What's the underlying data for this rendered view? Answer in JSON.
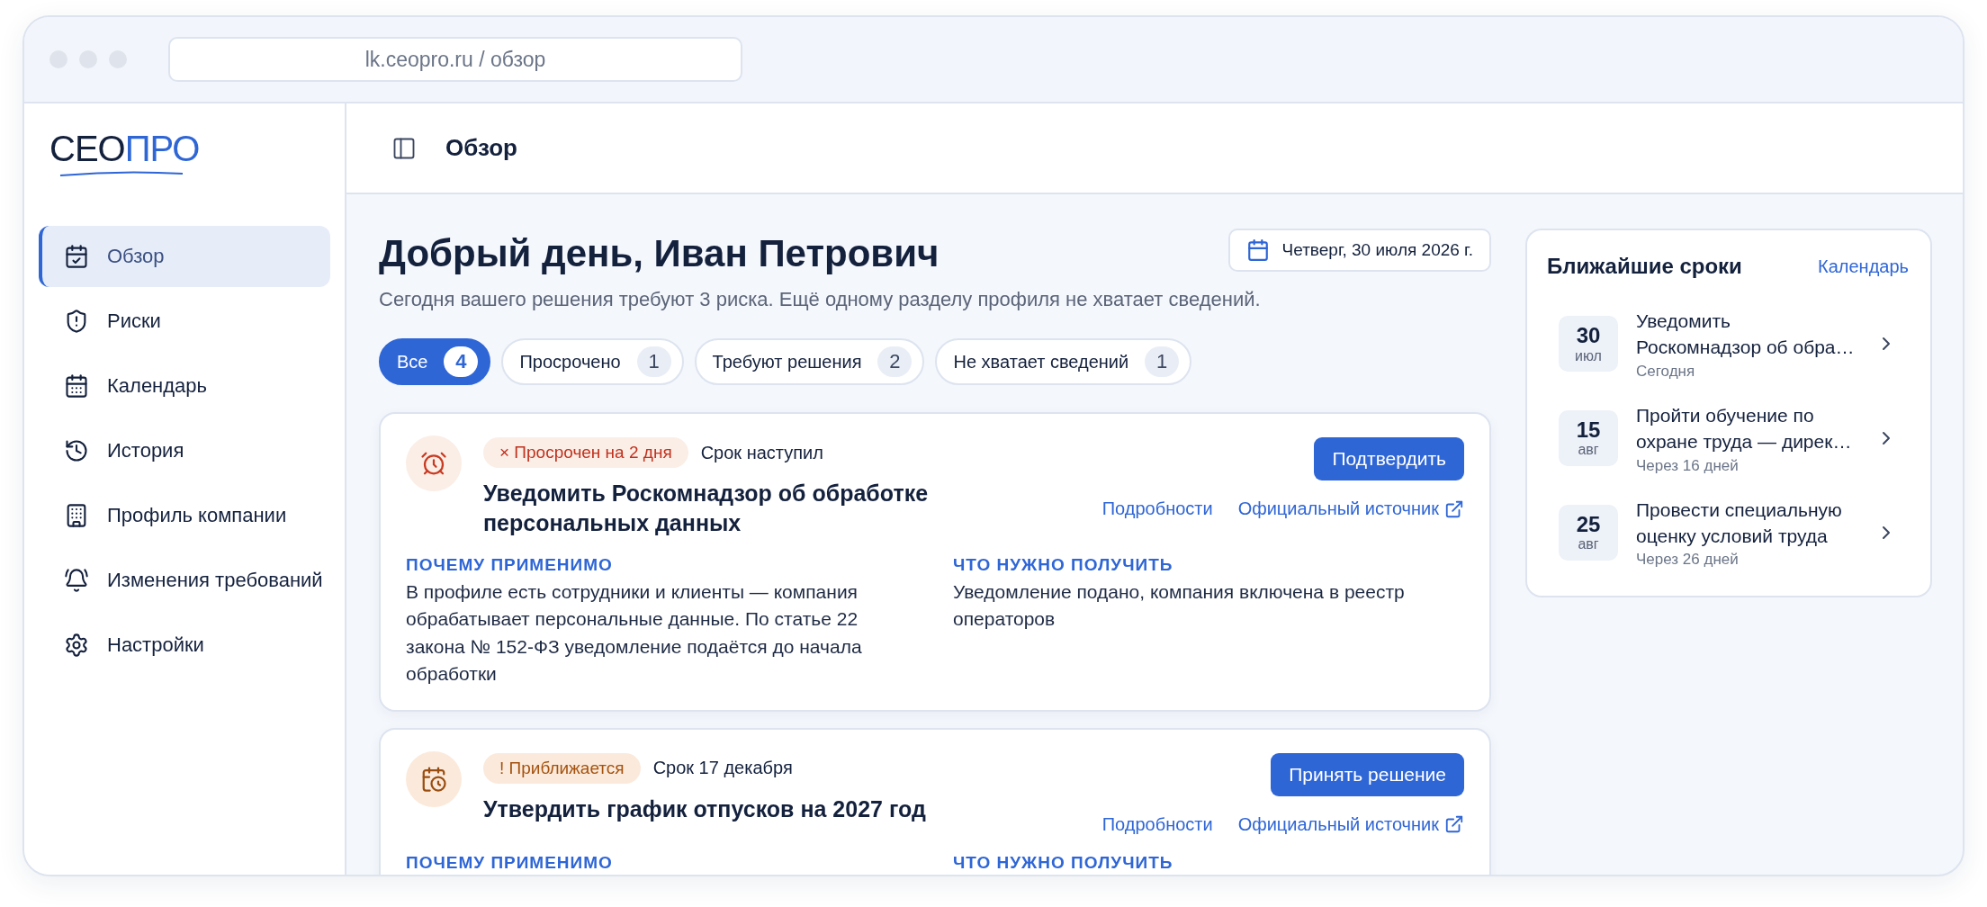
{
  "browser": {
    "address": "lk.ceopro.ru / обзор"
  },
  "logo": {
    "part_1": "СЕО",
    "part_2": "ПРО"
  },
  "sidebar": {
    "items": [
      {
        "label": "Обзор",
        "selected": true
      },
      {
        "label": "Риски",
        "selected": false
      },
      {
        "label": "Календарь",
        "selected": false
      },
      {
        "label": "История",
        "selected": false
      },
      {
        "label": "Профиль компании",
        "selected": false
      },
      {
        "label": "Изменения требований",
        "selected": false
      },
      {
        "label": "Настройки",
        "selected": false
      }
    ]
  },
  "header": {
    "title": "Обзор"
  },
  "greeting": {
    "title": "Добрый день, Иван Петрович",
    "subtitle": "Сегодня вашего решения требуют 3 риска. Ещё одному разделу профиля не хватает сведений.",
    "date": "Четверг, 30 июля 2026 г."
  },
  "filters": [
    {
      "label": "Все",
      "count": "4",
      "selected": true
    },
    {
      "label": "Просрочено",
      "count": "1",
      "selected": false
    },
    {
      "label": "Требуют решения",
      "count": "2",
      "selected": false
    },
    {
      "label": "Не хватает сведений",
      "count": "1",
      "selected": false
    }
  ],
  "tasks": [
    {
      "kind": "overdue",
      "badge": "× Просрочен на 2 дня",
      "deadline": "Срок наступил",
      "title": "Уведомить Роскомнадзор об обработке персональных данных",
      "action": "Подтвердить",
      "details_link": "Подробности",
      "source_link": "Официальный источник",
      "why_label": "ПОЧЕМУ ПРИМЕНИМО",
      "why_text": "В профиле есть сотрудники и клиенты — компания обрабатывает персональные данные. По статье 22 закона № 152-ФЗ уведомление подаётся до начала обработки",
      "result_label": "ЧТО НУЖНО ПОЛУЧИТЬ",
      "result_text": "Уведомление подано, компания включена в реестр операторов"
    },
    {
      "kind": "approaching",
      "badge": "! Приближается",
      "deadline": "Срок 17 декабря",
      "title": "Утвердить график отпусков на 2027 год",
      "action": "Принять решение",
      "details_link": "Подробности",
      "source_link": "Официальный источник",
      "why_label": "ПОЧЕМУ ПРИМЕНИМО",
      "result_label": "ЧТО НУЖНО ПОЛУЧИТЬ"
    }
  ],
  "upcoming": {
    "title": "Ближайшие сроки",
    "link": "Календарь",
    "items": [
      {
        "day": "30",
        "month": "июл",
        "title": "Уведомить Роскомнадзор об обра…",
        "when": "Сегодня"
      },
      {
        "day": "15",
        "month": "авг",
        "title": "Пройти обучение по охране труда — дирек…",
        "when": "Через 16 дней"
      },
      {
        "day": "25",
        "month": "авг",
        "title": "Провести специальную оценку условий труда",
        "when": "Через 26 дней"
      }
    ]
  }
}
